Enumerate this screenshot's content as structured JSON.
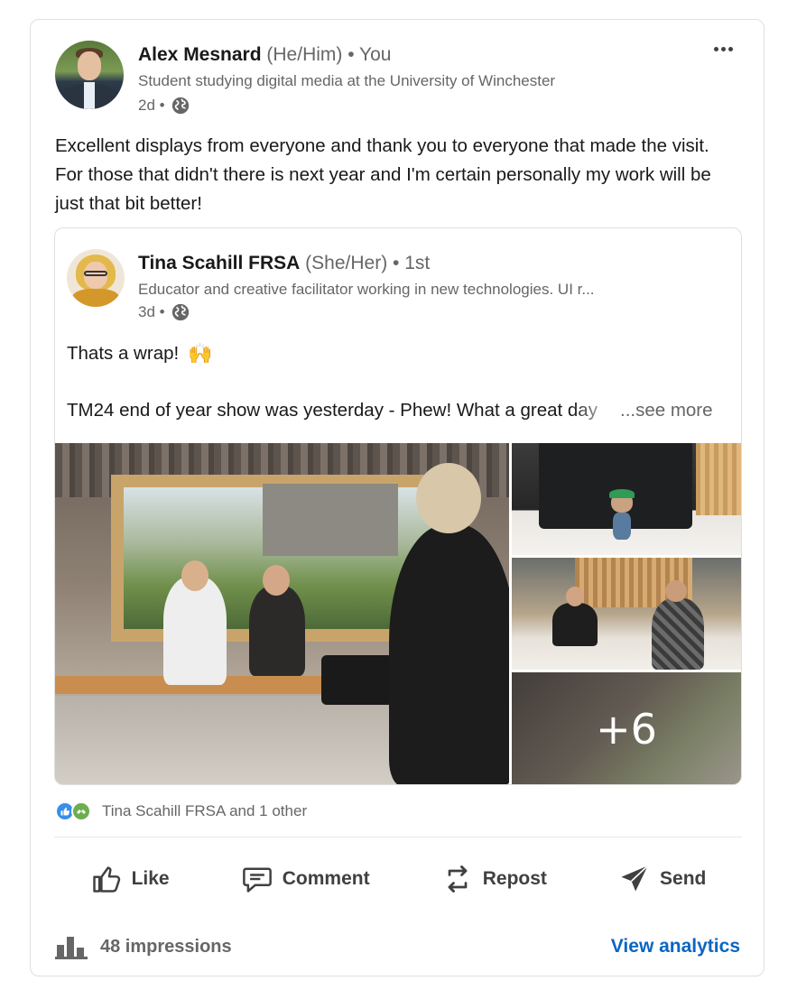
{
  "post": {
    "author": {
      "name": "Alex Mesnard",
      "pronouns": " (He/Him)",
      "degree": " • You",
      "headline": "Student studying digital media at the University of Winchester",
      "time": "2d •"
    },
    "text": "Excellent displays from everyone and thank you to everyone that made the visit. For those that didn't there is next year and I'm certain personally my work will be just that bit better!"
  },
  "shared_post": {
    "author": {
      "name": "Tina Scahill FRSA",
      "pronouns": " (She/Her)",
      "degree": " • 1st",
      "headline": "Educator and creative facilitator working in new technologies. UI r...",
      "time": "3d •"
    },
    "line1": "Thats a wrap!",
    "line2": "TM24 end of year show was yesterday - Phew! What a great day",
    "see_more": "...see more",
    "more_photos": "+6"
  },
  "social": {
    "reactions_text": "Tina Scahill FRSA and 1 other"
  },
  "actions": {
    "like": "Like",
    "comment": "Comment",
    "repost": "Repost",
    "send": "Send"
  },
  "analytics": {
    "impressions": "48 impressions",
    "link": "View analytics"
  },
  "icons": {
    "more": "more-horizontal-icon",
    "visibility": "globe-icon",
    "emoji": "raising-hands-emoji",
    "like": "thumbs-up-icon",
    "comment": "comment-icon",
    "repost": "repost-icon",
    "send": "send-icon",
    "impressions": "bar-chart-icon"
  },
  "colors": {
    "link": "#0a66c2",
    "text": "#191919",
    "muted": "#666666",
    "like_reaction": "#378fe9",
    "support_reaction": "#6dae4f"
  }
}
